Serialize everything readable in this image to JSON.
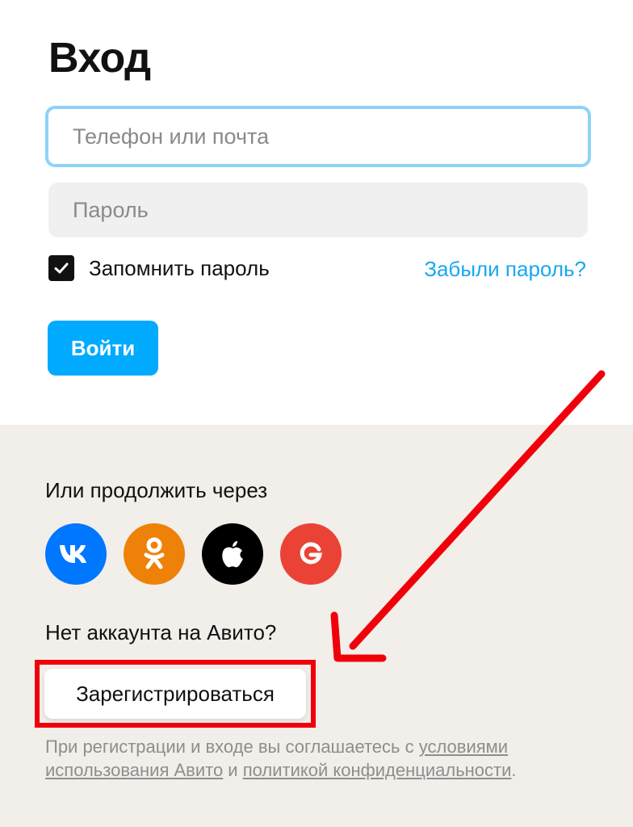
{
  "login": {
    "title": "Вход",
    "login_placeholder": "Телефон или почта",
    "password_placeholder": "Пароль",
    "remember_label": "Запомнить пароль",
    "remember_checked": true,
    "forgot_label": "Забыли пароль?",
    "submit_label": "Войти"
  },
  "social": {
    "heading": "Или продолжить через",
    "providers": [
      {
        "icon": "vk-icon",
        "color": "#0077ff"
      },
      {
        "icon": "odnoklassniki-icon",
        "color": "#ee8208"
      },
      {
        "icon": "apple-icon",
        "color": "#000000"
      },
      {
        "icon": "google-icon",
        "color": "#ea4335"
      }
    ]
  },
  "register": {
    "prompt": "Нет аккаунта на Авито?",
    "button_label": "Зарегистрироваться"
  },
  "legal": {
    "prefix": "При регистрации и входе вы соглашаетесь с ",
    "terms_link": "условиями использования Авито",
    "joiner": " и ",
    "privacy_link": "политикой конфиденциальности",
    "suffix": "."
  },
  "colors": {
    "accent": "#00aaff",
    "link": "#19a7f0",
    "annotation": "#f0000a",
    "bottom_background": "#f2eeea"
  }
}
